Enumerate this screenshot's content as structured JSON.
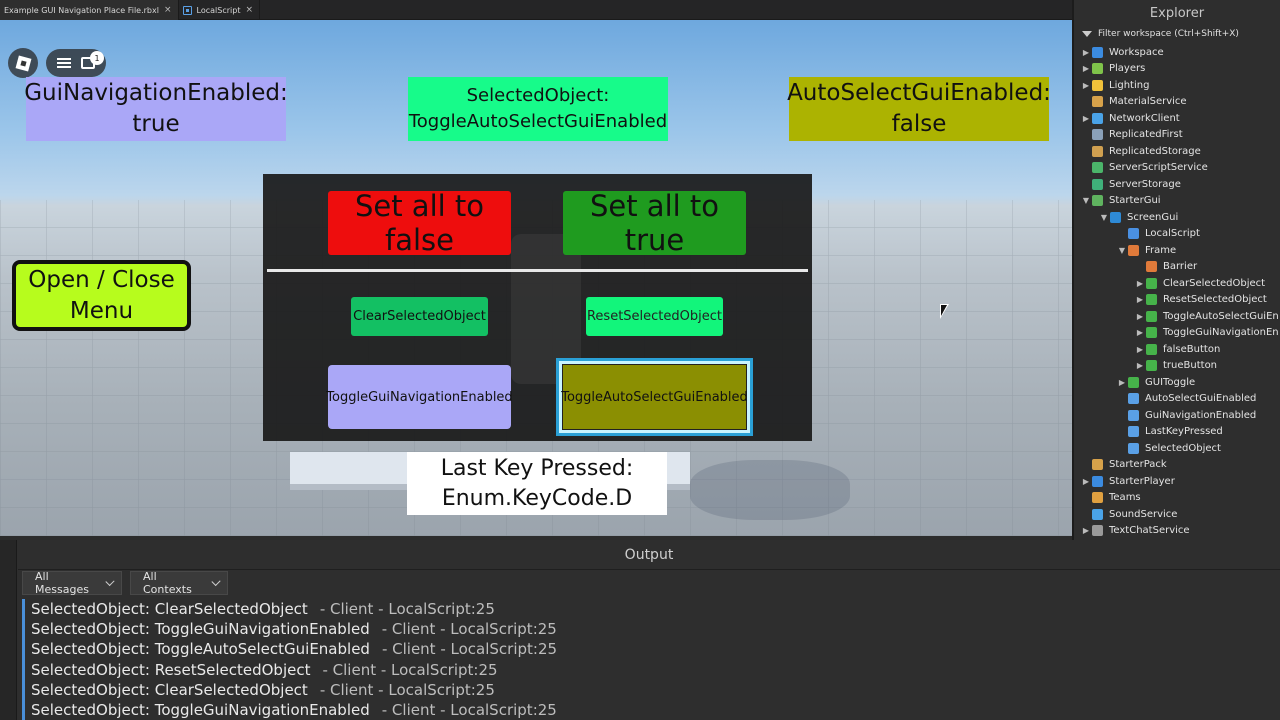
{
  "tabs": [
    {
      "label": "Example GUI Navigation Place File.rbxl",
      "close": "×"
    },
    {
      "label": "LocalScript",
      "close": "×"
    }
  ],
  "viewport": {
    "notification_count": "1",
    "gui_nav_label": "GuiNavigationEnabled:",
    "gui_nav_value": "true",
    "selected_label": "SelectedObject:",
    "selected_value": "ToggleAutoSelectGuiEnabled",
    "auto_select_label": "AutoSelectGuiEnabled:",
    "auto_select_value": "false",
    "open_close_line1": "Open / Close",
    "open_close_line2": "Menu",
    "last_key_label": "Last Key Pressed:",
    "last_key_value": "Enum.KeyCode.D",
    "frame": {
      "false_button": "Set all to false",
      "true_button": "Set all to true",
      "clear_button": "ClearSelectedObject",
      "reset_button": "ResetSelectedObject",
      "toggle_nav_button": "ToggleGuiNavigationEnabled",
      "toggle_auto_button": "ToggleAutoSelectGuiEnabled"
    }
  },
  "explorer": {
    "title": "Explorer",
    "filter": "Filter workspace (Ctrl+Shift+X)",
    "items": [
      {
        "label": "Workspace",
        "indent": 0,
        "arrow": "▶",
        "icon_color": "#3b8be0"
      },
      {
        "label": "Players",
        "indent": 0,
        "arrow": "▶",
        "icon_color": "#7fc34a"
      },
      {
        "label": "Lighting",
        "indent": 0,
        "arrow": "▶",
        "icon_color": "#f2c23a"
      },
      {
        "label": "MaterialService",
        "indent": 0,
        "arrow": "",
        "icon_color": "#d7a24a"
      },
      {
        "label": "NetworkClient",
        "indent": 0,
        "arrow": "▶",
        "icon_color": "#4aa3e8"
      },
      {
        "label": "ReplicatedFirst",
        "indent": 0,
        "arrow": "",
        "icon_color": "#8aa0b8"
      },
      {
        "label": "ReplicatedStorage",
        "indent": 0,
        "arrow": "",
        "icon_color": "#d0a050"
      },
      {
        "label": "ServerScriptService",
        "indent": 0,
        "arrow": "",
        "icon_color": "#4bb56a"
      },
      {
        "label": "ServerStorage",
        "indent": 0,
        "arrow": "",
        "icon_color": "#3fb07a"
      },
      {
        "label": "StarterGui",
        "indent": 0,
        "arrow": "▼",
        "icon_color": "#5fb35f"
      },
      {
        "label": "ScreenGui",
        "indent": 1,
        "arrow": "▼",
        "icon_color": "#2e8ad6"
      },
      {
        "label": "LocalScript",
        "indent": 2,
        "arrow": "",
        "icon_color": "#4a90e2"
      },
      {
        "label": "Frame",
        "indent": 2,
        "arrow": "▼",
        "icon_color": "#e07a3a"
      },
      {
        "label": "Barrier",
        "indent": 3,
        "arrow": "",
        "icon_color": "#e07a3a"
      },
      {
        "label": "ClearSelectedObject",
        "indent": 3,
        "arrow": "▶",
        "icon_color": "#46b34a"
      },
      {
        "label": "ResetSelectedObject",
        "indent": 3,
        "arrow": "▶",
        "icon_color": "#46b34a"
      },
      {
        "label": "ToggleAutoSelectGuiEn",
        "indent": 3,
        "arrow": "▶",
        "icon_color": "#46b34a"
      },
      {
        "label": "ToggleGuiNavigationEn",
        "indent": 3,
        "arrow": "▶",
        "icon_color": "#46b34a"
      },
      {
        "label": "falseButton",
        "indent": 3,
        "arrow": "▶",
        "icon_color": "#46b34a"
      },
      {
        "label": "trueButton",
        "indent": 3,
        "arrow": "▶",
        "icon_color": "#46b34a"
      },
      {
        "label": "GUIToggle",
        "indent": 2,
        "arrow": "▶",
        "icon_color": "#46b34a"
      },
      {
        "label": "AutoSelectGuiEnabled",
        "indent": 2,
        "arrow": "",
        "icon_color": "#5aa0e6"
      },
      {
        "label": "GuiNavigationEnabled",
        "indent": 2,
        "arrow": "",
        "icon_color": "#5aa0e6"
      },
      {
        "label": "LastKeyPressed",
        "indent": 2,
        "arrow": "",
        "icon_color": "#5aa0e6"
      },
      {
        "label": "SelectedObject",
        "indent": 2,
        "arrow": "",
        "icon_color": "#5aa0e6"
      },
      {
        "label": "StarterPack",
        "indent": 0,
        "arrow": "",
        "icon_color": "#d7a24a"
      },
      {
        "label": "StarterPlayer",
        "indent": 0,
        "arrow": "▶",
        "icon_color": "#3b8be0"
      },
      {
        "label": "Teams",
        "indent": 0,
        "arrow": "",
        "icon_color": "#e0a040"
      },
      {
        "label": "SoundService",
        "indent": 0,
        "arrow": "",
        "icon_color": "#4aa3e8"
      },
      {
        "label": "TextChatService",
        "indent": 0,
        "arrow": "▶",
        "icon_color": "#9a9a9a"
      }
    ]
  },
  "output": {
    "title": "Output",
    "messages_filter": "All Messages",
    "contexts_filter": "All Contexts",
    "logs": [
      {
        "text": "SelectedObject: ClearSelectedObject",
        "meta": " -  Client - LocalScript:25"
      },
      {
        "text": "SelectedObject: ToggleGuiNavigationEnabled",
        "meta": " -  Client - LocalScript:25"
      },
      {
        "text": "SelectedObject: ToggleAutoSelectGuiEnabled",
        "meta": " -  Client - LocalScript:25"
      },
      {
        "text": "SelectedObject: ResetSelectedObject",
        "meta": " -  Client - LocalScript:25"
      },
      {
        "text": "SelectedObject: ClearSelectedObject",
        "meta": " -  Client - LocalScript:25"
      },
      {
        "text": "SelectedObject: ToggleGuiNavigationEnabled",
        "meta": " -  Client - LocalScript:25"
      }
    ]
  }
}
